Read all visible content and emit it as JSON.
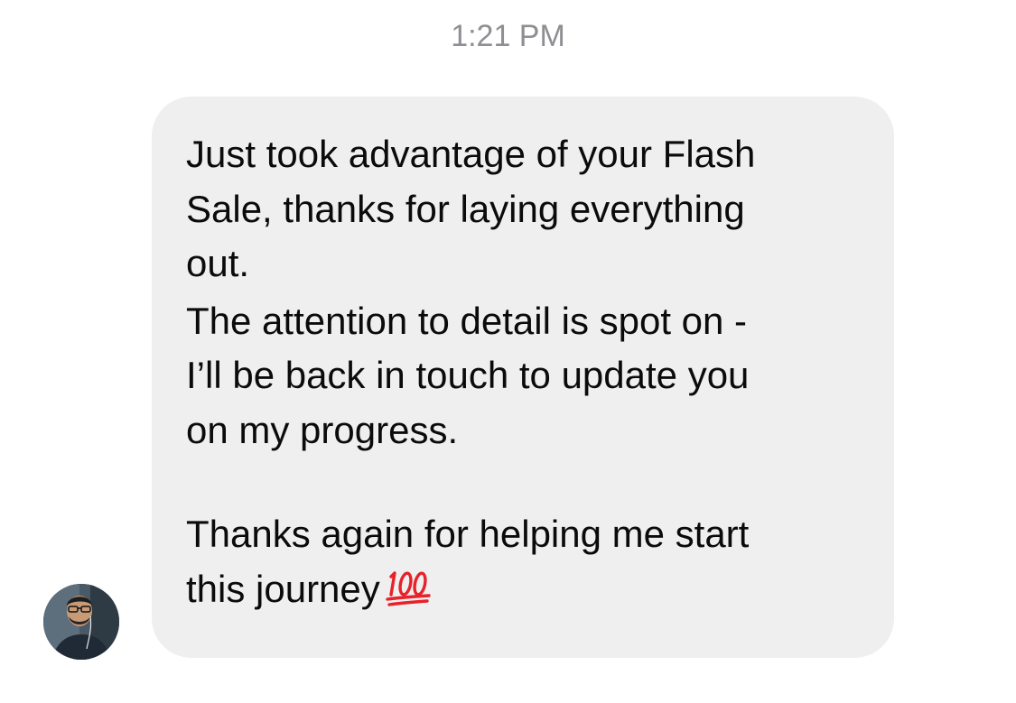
{
  "timestamp": "1:21 PM",
  "message": {
    "paragraph_1": [
      "Just took advantage of your Flash",
      "Sale, thanks for laying everything",
      "out."
    ],
    "paragraph_2": [
      "The attention to detail is spot on -",
      "I’ll be back in touch to update you",
      "on my progress."
    ],
    "paragraph_3": [
      "Thanks again for helping me start",
      "this journey"
    ],
    "emoji": "hundred-points-emoji",
    "emoji_text": "100"
  },
  "avatar": {
    "icon": "user-avatar-photo"
  },
  "colors": {
    "bubble_background": "#efefef",
    "text": "#0b0b0b",
    "timestamp": "#8e8e93",
    "emoji_red": "#e8212a"
  }
}
